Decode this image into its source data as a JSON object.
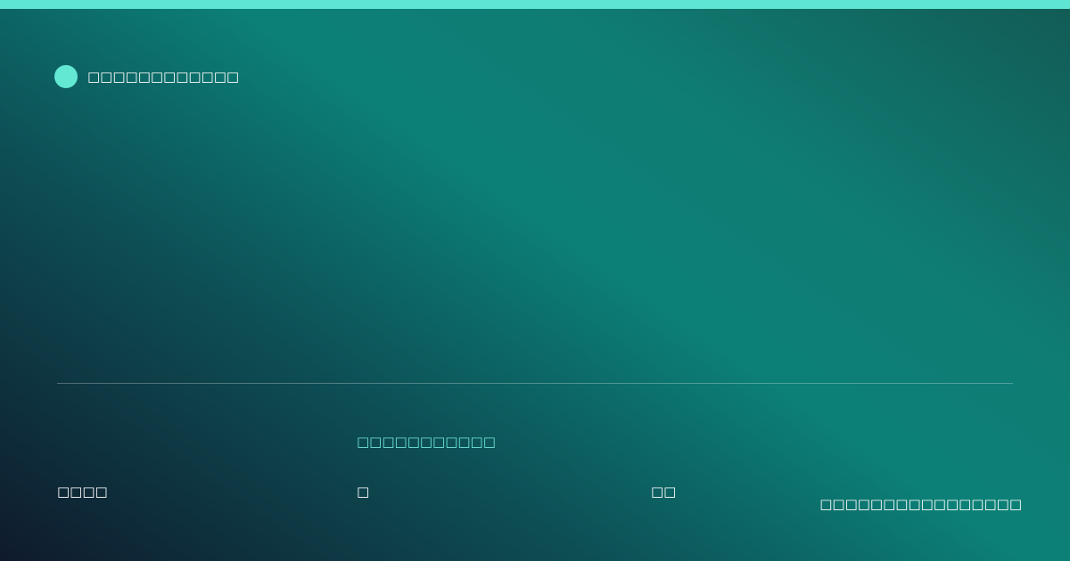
{
  "brand": {
    "name": "□□□□□□□□□□□□",
    "accent_color": "#63e8d4",
    "dot_icon": "circle-logo-icon"
  },
  "caption": "□□□□□□□□□□□",
  "meta": {
    "first": "□□□□",
    "second": "□",
    "third": "□□"
  },
  "footer_note": "□□□□□□□□□□□□□□□□",
  "colors": {
    "top_bar": "#5ee6d3",
    "caption": "#6fe7d6",
    "text": "#ffffff"
  }
}
